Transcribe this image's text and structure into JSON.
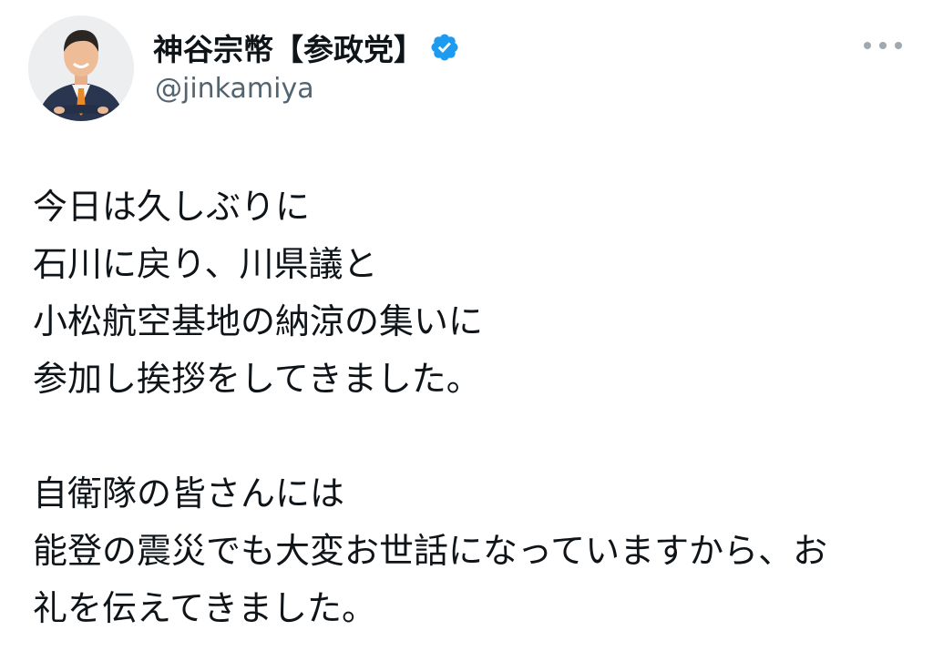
{
  "author": {
    "display_name": "神谷宗幣【参政党】",
    "handle": "@jinkamiya",
    "verified_icon": "verified-badge-icon",
    "avatar": "profile-photo"
  },
  "more_icon": "more-horizontal-icon",
  "colors": {
    "text": "#0f1419",
    "secondary": "#536471",
    "verified": "#1d9bf0",
    "more_dots": "#a0a8b0"
  },
  "tweet": {
    "lines": [
      "今日は久しぶりに",
      "石川に戻り、川県議と",
      "小松航空基地の納涼の集いに",
      "参加し挨拶をしてきました。"
    ],
    "lines2": [
      "自衛隊の皆さんには",
      "能登の震災でも大変お世話になっていますから、お",
      "礼を伝えてきました。"
    ]
  }
}
